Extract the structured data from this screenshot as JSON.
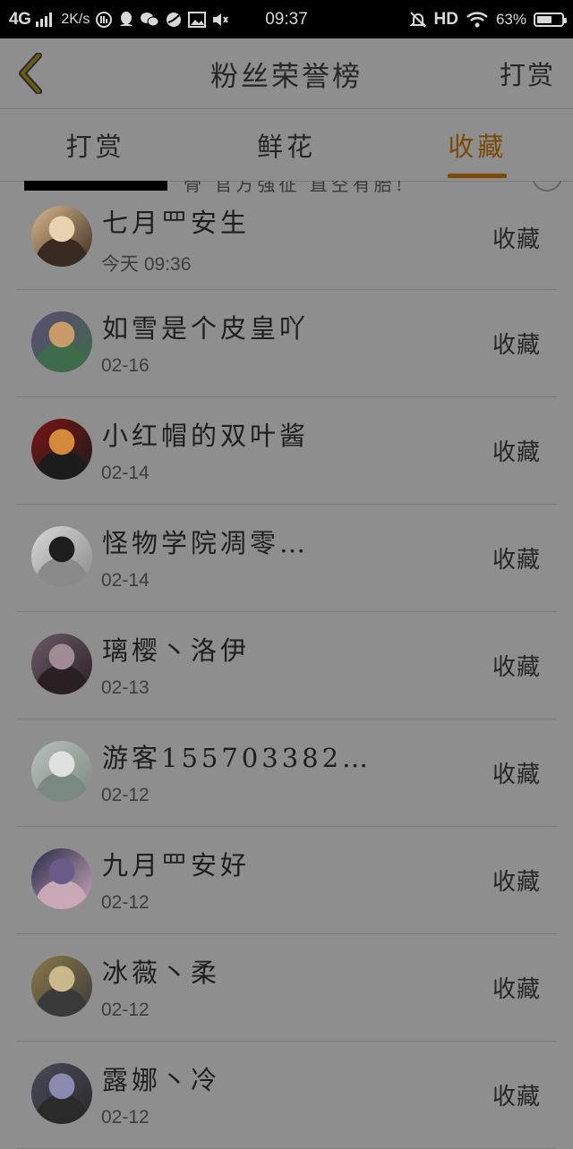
{
  "status_bar": {
    "network": "4G",
    "speed": "2K/s",
    "time": "09:37",
    "hd": "HD",
    "battery_pct": "63%",
    "battery_level": 0.63
  },
  "header": {
    "title": "粉丝荣誉榜",
    "action": "打赏"
  },
  "tabs": [
    {
      "label": "打赏",
      "active": false
    },
    {
      "label": "鲜花",
      "active": false
    },
    {
      "label": "收藏",
      "active": true
    }
  ],
  "peek_text": "骨  官方强征  直空有胎!",
  "colors": {
    "accent": "#7a4a06",
    "background": "#8e8e8e"
  },
  "list": [
    {
      "name": "七月罒安生",
      "date": "今天 09:36",
      "action": "收藏",
      "avatar_colors": [
        "#d9b98c",
        "#e8d2b0",
        "#3a2b22"
      ]
    },
    {
      "name": "如雪是个皮皇吖",
      "date": "02-16",
      "action": "收藏",
      "avatar_colors": [
        "#5a4b72",
        "#c99b6a",
        "#3e6b4a"
      ]
    },
    {
      "name": "小红帽的双叶酱",
      "date": "02-14",
      "action": "收藏",
      "avatar_colors": [
        "#7a1414",
        "#d58a3a",
        "#1c1c1c"
      ]
    },
    {
      "name": "怪物学院凋零…",
      "date": "02-14",
      "action": "收藏",
      "avatar_colors": [
        "#d8d8d8",
        "#1e1e1e",
        "#8a8a8a"
      ]
    },
    {
      "name": "璃樱丶洛伊",
      "date": "02-13",
      "action": "收藏",
      "avatar_colors": [
        "#6b5a66",
        "#a08a95",
        "#2a2024"
      ]
    },
    {
      "name": "游客155703382…",
      "date": "02-12",
      "action": "收藏",
      "avatar_colors": [
        "#b9c1bc",
        "#e0e0e0",
        "#7a8a80"
      ]
    },
    {
      "name": "九月罒安好",
      "date": "02-12",
      "action": "收藏",
      "avatar_colors": [
        "#2a2a4a",
        "#6a5a8a",
        "#c9a8b8"
      ]
    },
    {
      "name": "冰薇丶柔",
      "date": "02-12",
      "action": "收藏",
      "avatar_colors": [
        "#8a7a4a",
        "#c9b88a",
        "#3a3a3a"
      ]
    },
    {
      "name": "露娜丶冷",
      "date": "02-12",
      "action": "收藏",
      "avatar_colors": [
        "#4a4a5a",
        "#8a8ab0",
        "#2a2a2a"
      ]
    }
  ]
}
